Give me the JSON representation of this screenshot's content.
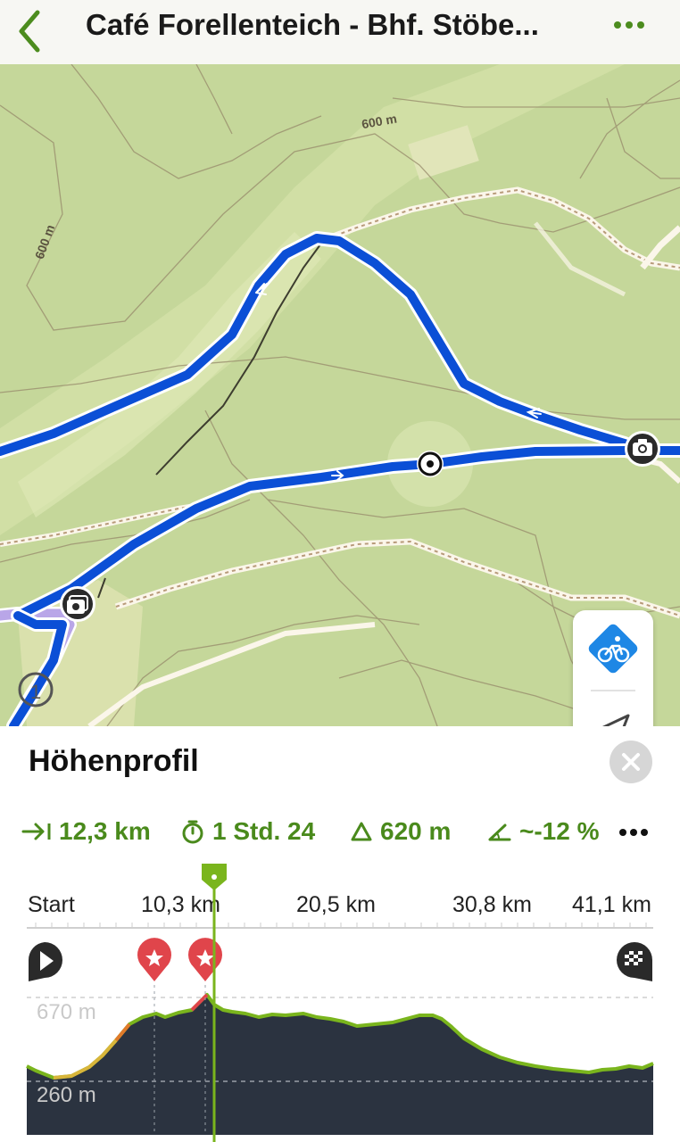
{
  "header": {
    "title": "Café Forellenteich - Bhf. Stöbe...",
    "back_icon": "chevron-left-icon",
    "more_icon": "ellipsis-icon"
  },
  "map": {
    "contour_labels": [
      "600 m",
      "600 m"
    ],
    "route_color": "#0b4fd6",
    "side_route_color": "#b9a6e8",
    "controls": {
      "cycling_layer_icon": "bike-layer-icon",
      "locate_icon": "location-arrow-icon"
    }
  },
  "elevation_profile": {
    "title": "Höhenprofil",
    "close_icon": "close-icon",
    "stats": {
      "distance": "12,3 km",
      "duration": "1 Std. 24",
      "ascent": "620 m",
      "gradient": "~-12 %"
    },
    "distance_ticks": [
      "Start",
      "10,3 km",
      "20,5 km",
      "30,8 km",
      "41,1 km"
    ],
    "elevation_labels": [
      "670 m",
      "260 m"
    ],
    "accent_color": "#7ab51d",
    "fill_color": "#2b3340",
    "marker_color": "#e0454b"
  }
}
